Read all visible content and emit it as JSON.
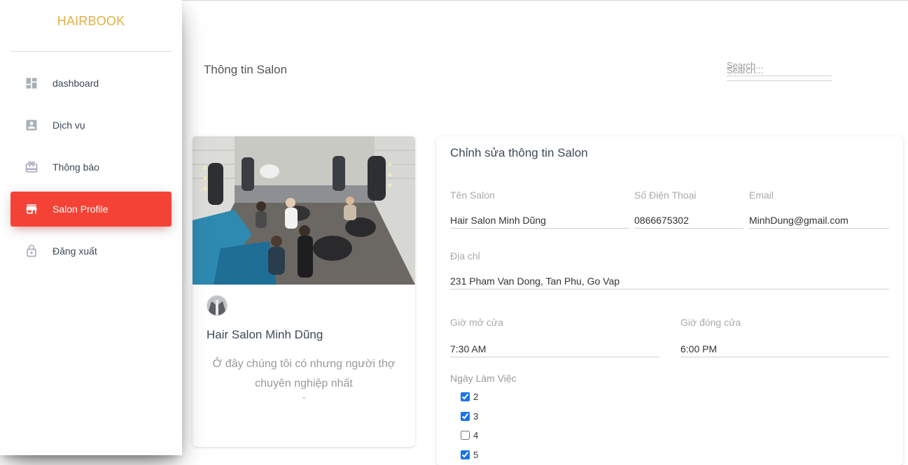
{
  "brand": "HAIRBOOK",
  "sidebar": {
    "items": [
      {
        "label": "dashboard",
        "icon": "dashboard-icon"
      },
      {
        "label": "Dịch vụ",
        "icon": "person-box-icon"
      },
      {
        "label": "Thông báo",
        "icon": "gift-icon"
      },
      {
        "label": "Salon Profile",
        "icon": "store-icon",
        "active": true
      },
      {
        "label": "Đăng xuất",
        "icon": "lock-icon"
      }
    ]
  },
  "header": {
    "title": "Thông tin Salon",
    "search_placeholder": "Search...",
    "search_ghost": "Search..."
  },
  "profile": {
    "name": "Hair Salon Minh Dũng",
    "description": "Ở đây chúng tôi có nhưng người thợ chuyên nghiệp nhất",
    "quote": "\""
  },
  "form": {
    "title": "Chỉnh sửa thông tin Salon",
    "salon_name_label": "Tên Salon",
    "salon_name_value": "Hair Salon Minh Dũng",
    "phone_label": "Số Điện Thoại",
    "phone_value": "0866675302",
    "email_label": "Email",
    "email_value": "MinhDung@gmail.com",
    "address_label": "Địa chỉ",
    "address_value": "231 Pham Van Dong, Tan Phu, Go Vap",
    "open_label": "Giờ mở cửa",
    "open_value": "7:30 AM",
    "close_label": "Giờ đóng cửa",
    "close_value": "6:00 PM",
    "workdays_label": "Ngày Làm Việc",
    "workdays": [
      {
        "label": "2",
        "checked": true
      },
      {
        "label": "3",
        "checked": true
      },
      {
        "label": "4",
        "checked": false
      },
      {
        "label": "5",
        "checked": true
      }
    ]
  },
  "colors": {
    "brand": "#e0b142",
    "active": "#f44336",
    "icon": "#a9afbb",
    "checkbox": "#1a73e8"
  }
}
